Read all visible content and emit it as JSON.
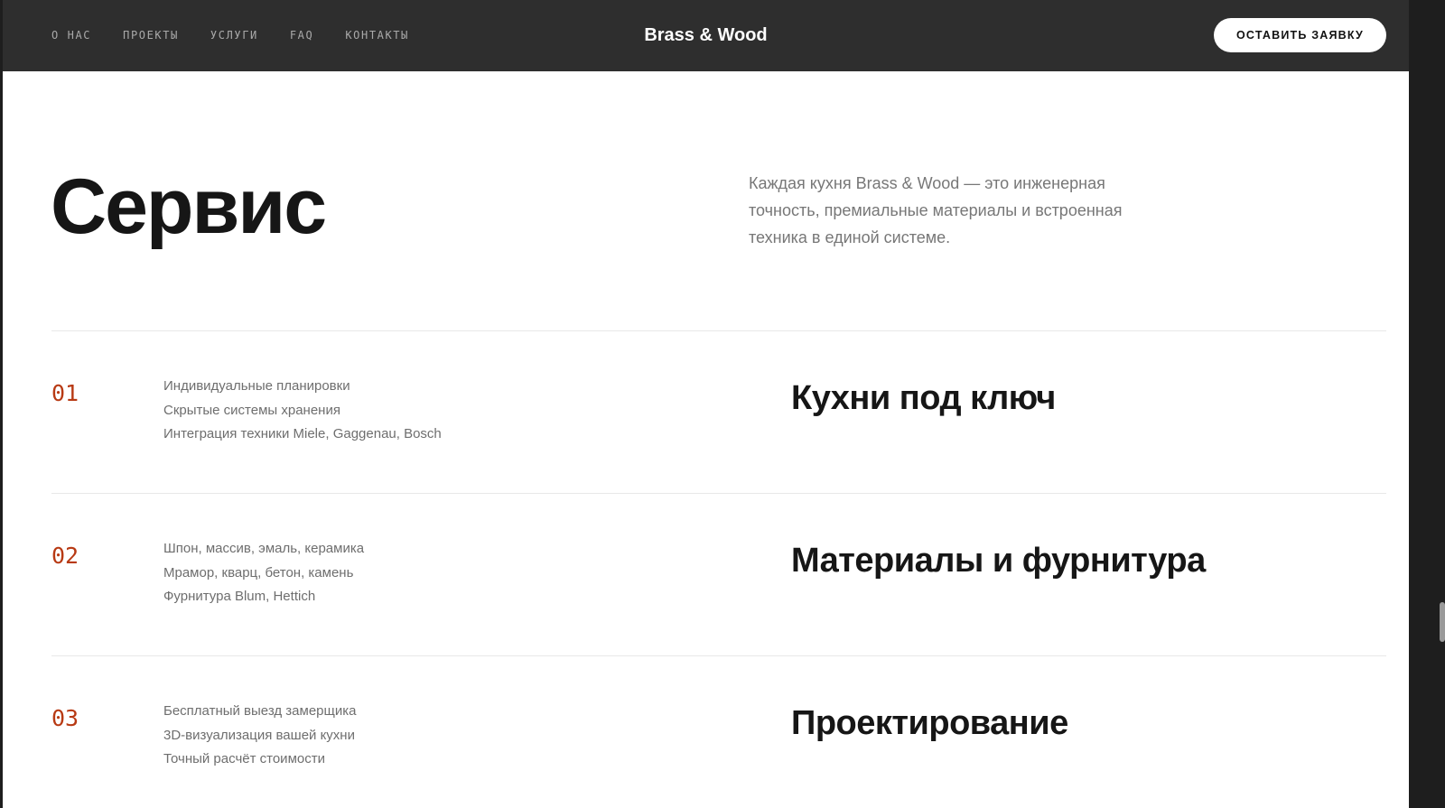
{
  "header": {
    "nav": [
      "О НАС",
      "ПРОЕКТЫ",
      "УСЛУГИ",
      "FAQ",
      "КОНТАКТЫ"
    ],
    "logo": "Brass & Wood",
    "cta_label": "ОСТАВИТЬ ЗАЯВКУ"
  },
  "hero": {
    "title": "Сервис",
    "description": "Каждая кухня Brass & Wood — это инженерная точность, премиальные материалы и встроенная техника в единой системе."
  },
  "services": [
    {
      "number": "01",
      "features": [
        "Индивидуальные планировки",
        "Скрытые системы хранения",
        "Интеграция техники Miele, Gaggenau, Bosch"
      ],
      "title": "Кухни под ключ"
    },
    {
      "number": "02",
      "features": [
        "Шпон, массив, эмаль, керамика",
        "Мрамор, кварц, бетон, камень",
        "Фурнитура Blum, Hettich"
      ],
      "title": "Материалы и фурнитура"
    },
    {
      "number": "03",
      "features": [
        "Бесплатный выезд замерщика",
        "3D-визуализация вашей кухни",
        "Точный расчёт стоимости"
      ],
      "title": "Проектирование"
    }
  ],
  "colors": {
    "header_bg": "#2e2e2e",
    "accent": "#b83a14",
    "text_dark": "#161616",
    "text_muted": "#6e6e6e"
  }
}
